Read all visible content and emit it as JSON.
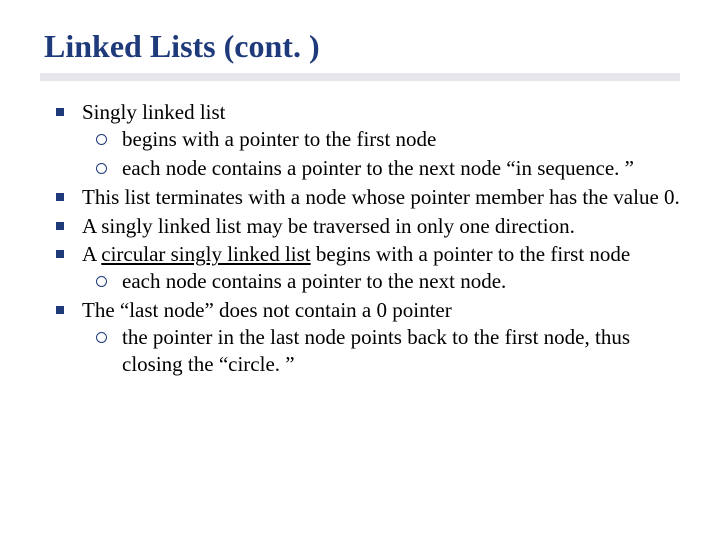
{
  "title": "Linked Lists (cont. )",
  "b1": "Singly linked list",
  "b1s1": "begins with a pointer to the first node",
  "b1s2": "each node contains a pointer to the next node “in sequence. ”",
  "b2": "This list terminates with a node whose pointer member has the value 0.",
  "b3": "A singly linked list may be traversed in only one direction.",
  "b4pre": "A ",
  "b4u": "circular singly linked list",
  "b4post": " begins with a pointer to the first node",
  "b4s1": "each node contains a pointer to the next node.",
  "b5": "The “last node” does not contain a 0 pointer",
  "b5s1": "the pointer in the last node points back to the first node, thus closing the “circle. ”"
}
